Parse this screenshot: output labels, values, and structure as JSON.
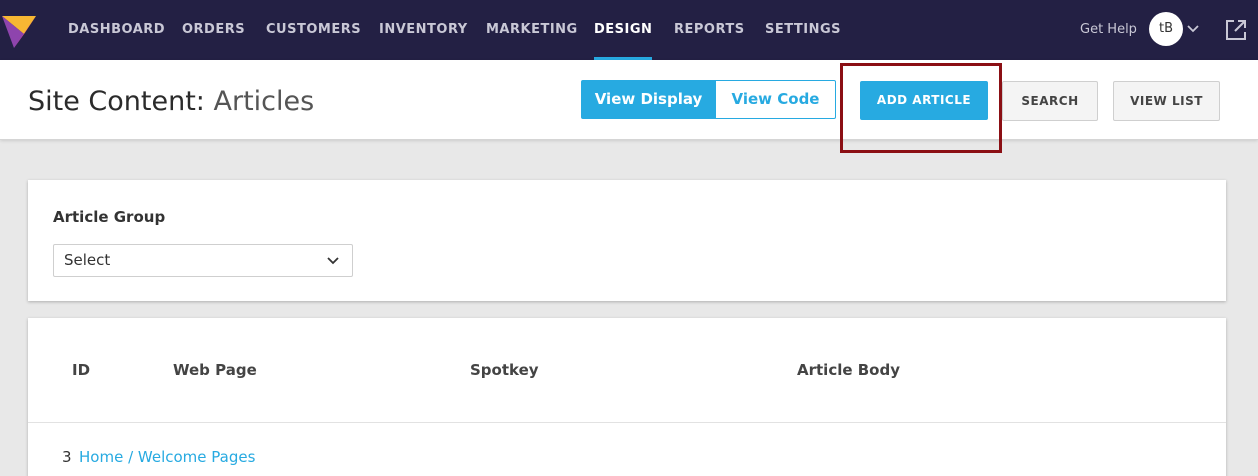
{
  "nav": {
    "items": [
      {
        "label": "DASHBOARD",
        "active": false
      },
      {
        "label": "ORDERS",
        "active": false
      },
      {
        "label": "CUSTOMERS",
        "active": false
      },
      {
        "label": "INVENTORY",
        "active": false
      },
      {
        "label": "MARKETING",
        "active": false
      },
      {
        "label": "DESIGN",
        "active": true
      },
      {
        "label": "REPORTS",
        "active": false
      },
      {
        "label": "SETTINGS",
        "active": false
      }
    ],
    "get_help": "Get Help",
    "avatar_initials": "tB",
    "bg_color": "#232044",
    "accent_color": "#27aae1"
  },
  "header": {
    "title_strong": "Site Content:",
    "title_light": "Articles",
    "view_display": "View Display",
    "view_code": "View Code",
    "add_article": "ADD ARTICLE",
    "search": "SEARCH",
    "view_list": "VIEW LIST"
  },
  "filter": {
    "label": "Article Group",
    "select_value": "Select"
  },
  "table": {
    "columns": [
      "ID",
      "Web Page",
      "Spotkey",
      "Article Body"
    ],
    "rows": [
      {
        "id": "3",
        "web_page": "Home / Welcome Pages",
        "spotkey": "",
        "article_body": ""
      }
    ]
  },
  "highlight_color": "#8b0f14"
}
